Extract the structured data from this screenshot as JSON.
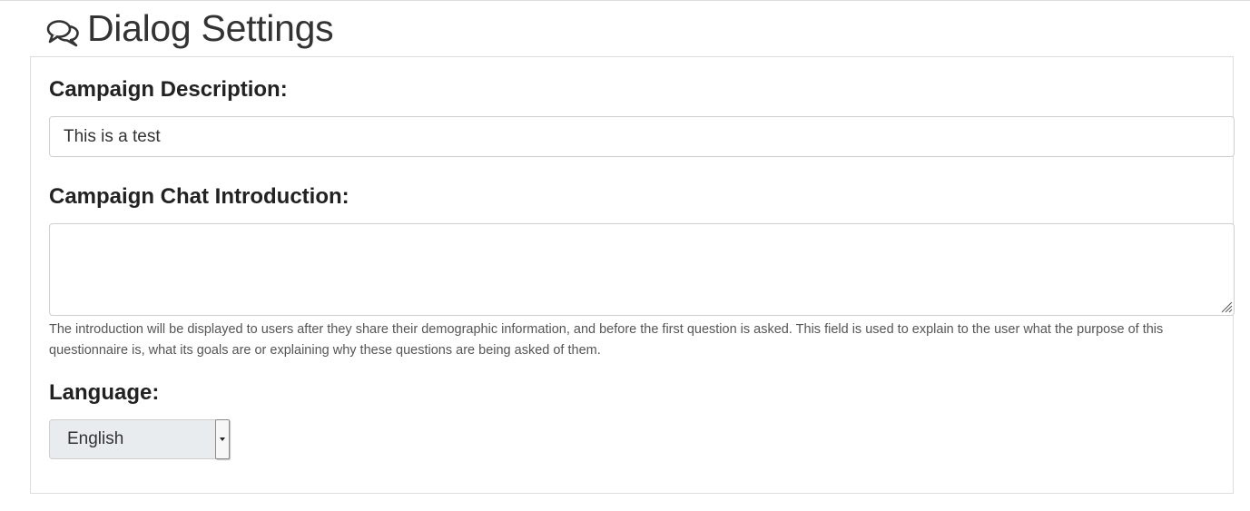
{
  "page": {
    "title": "Dialog Settings",
    "title_icon": "comments-icon"
  },
  "form": {
    "description_label": "Campaign Description:",
    "description_value": "This is a test",
    "intro_label": "Campaign Chat Introduction:",
    "intro_value": "",
    "intro_help": "The introduction will be displayed to users after they share their demographic information, and before the first question is asked. This field is used to explain to the user what the purpose of this questionnaire is, what its goals are or explaining why these questions are being asked of them.",
    "language_label": "Language:",
    "language_selected": "English"
  },
  "colors": {
    "text": "#222222",
    "help_text": "#555555",
    "select_bg": "#e9ecef",
    "border": "#cfcfcf"
  }
}
